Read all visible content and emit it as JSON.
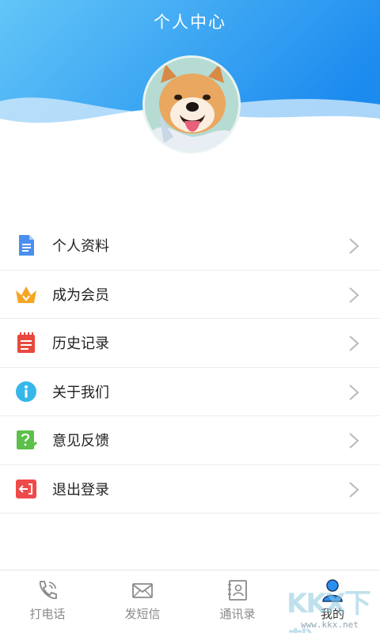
{
  "header": {
    "title": "个人中心",
    "gradient_start": "#5bc2f6",
    "gradient_end": "#1f8ef0"
  },
  "avatar": {
    "subject": "shiba-inu-watercolor-portrait"
  },
  "menu": {
    "items": [
      {
        "label": "个人资料",
        "icon": "profile-document-icon",
        "color": "#4a8ff0"
      },
      {
        "label": "成为会员",
        "icon": "crown-icon",
        "color": "#f5a623"
      },
      {
        "label": "历史记录",
        "icon": "history-notepad-icon",
        "color": "#e8483e"
      },
      {
        "label": "关于我们",
        "icon": "info-icon",
        "color": "#36b7ea"
      },
      {
        "label": "意见反馈",
        "icon": "feedback-question-icon",
        "color": "#5cc04a"
      },
      {
        "label": "退出登录",
        "icon": "logout-icon",
        "color": "#ef4a4a"
      }
    ]
  },
  "tabbar": {
    "tabs": [
      {
        "label": "打电话",
        "icon": "phone-icon",
        "active": false
      },
      {
        "label": "发短信",
        "icon": "envelope-icon",
        "active": false
      },
      {
        "label": "通讯录",
        "icon": "contacts-book-icon",
        "active": false
      },
      {
        "label": "我的",
        "icon": "user-icon",
        "active": true
      }
    ],
    "active_color": "#2b8ff2"
  },
  "watermark": {
    "logo": "KKX下载",
    "url": "www.kkx.net"
  }
}
